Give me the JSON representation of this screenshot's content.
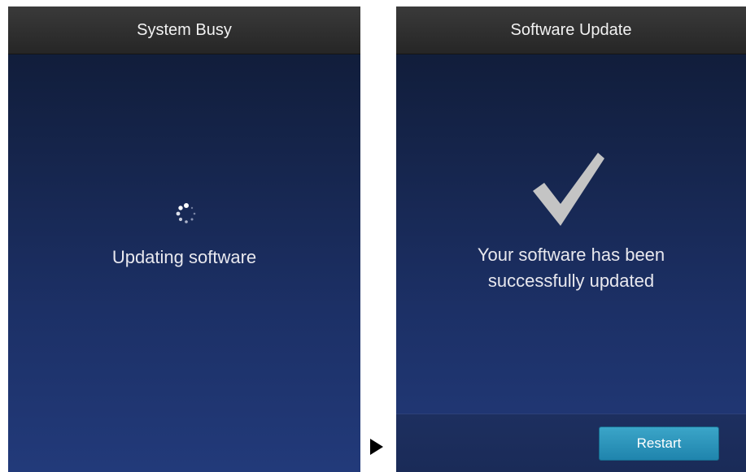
{
  "left_screen": {
    "title": "System Busy",
    "icon": "spinner-icon",
    "message": "Updating software"
  },
  "right_screen": {
    "title": "Software Update",
    "icon": "checkmark-icon",
    "message_line1": "Your software has been",
    "message_line2": "successfully updated",
    "restart_label": "Restart"
  },
  "transition_icon": "play-arrow-icon",
  "colors": {
    "title_bar": "#2e2e2e",
    "screen_top": "#0f1a33",
    "screen_bottom": "#223a7a",
    "button_accent": "#2a95bd",
    "checkmark": "#c4c4c4"
  }
}
